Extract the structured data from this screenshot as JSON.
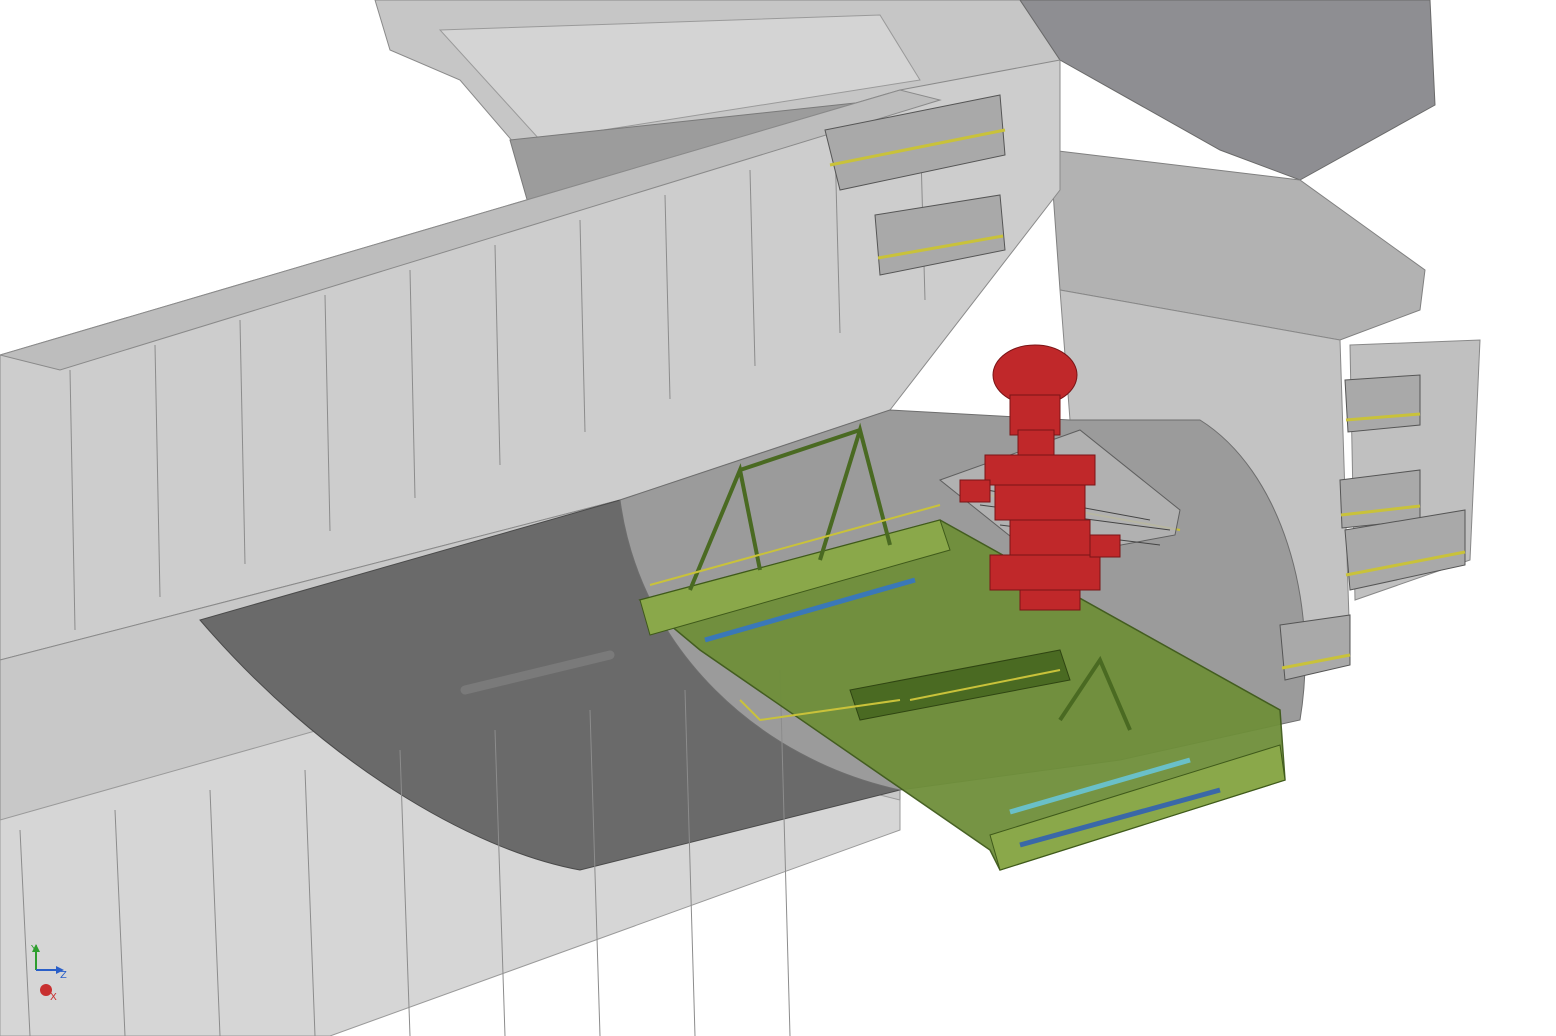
{
  "viewport": {
    "background": "#ffffff"
  },
  "model": {
    "hull_color": "#c8c8c8",
    "hull_dark": "#8a8a8a",
    "hull_shadow": "#5c5c5c",
    "structure_color": "#6f8f3a",
    "structure_dark": "#4a6a22",
    "equipment_color": "#c0282a",
    "railing_color": "#c9c23a",
    "pipe_color": "#3aa0c8"
  },
  "triad": {
    "y_label": "Y",
    "z_label": "Z",
    "x_label": "X",
    "y_color": "#2e9e2e",
    "z_color": "#2a5fc8",
    "x_color": "#c83030"
  }
}
